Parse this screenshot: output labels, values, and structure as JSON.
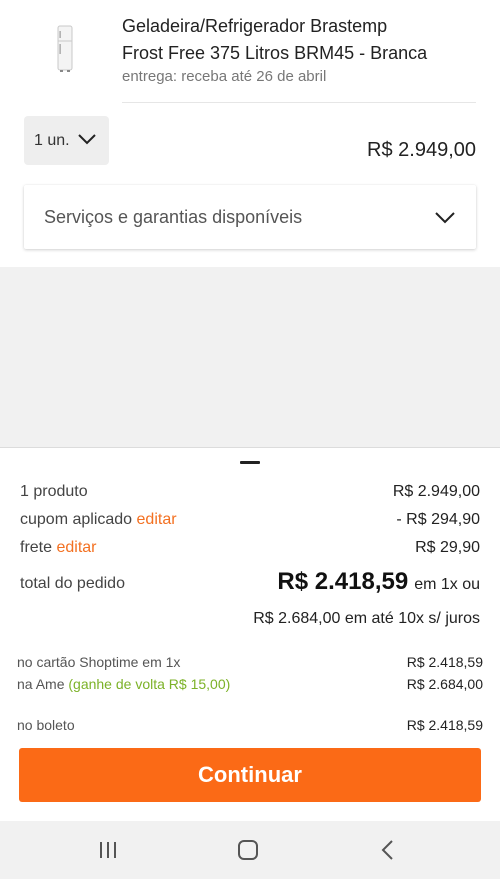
{
  "product": {
    "title_line1": "Geladeira/Refrigerador Brastemp",
    "title_line2": "Frost Free 375 Litros BRM45 - Branca",
    "delivery": "entrega: receba até 26 de abril",
    "thumb_icon": "refrigerator-image"
  },
  "quantity": {
    "selected": "1 un.",
    "icon": "chevron-down-icon"
  },
  "price": "R$ 2.949,00",
  "services": {
    "label": "Serviços e garantias disponíveis",
    "icon": "chevron-down-icon"
  },
  "summary": {
    "products_label": "1 produto",
    "products_value": "R$ 2.949,00",
    "coupon_label": "cupom aplicado",
    "coupon_edit": "editar",
    "coupon_value": "- R$ 294,90",
    "shipping_label": "frete",
    "shipping_edit": "editar",
    "shipping_value": "R$ 29,90",
    "total_label": "total do pedido",
    "total_value": "R$ 2.418,59",
    "total_suffix": "em 1x ou",
    "installments": "R$ 2.684,00 em até 10x s/ juros"
  },
  "payment": {
    "card_label": "no cartão Shoptime em 1x",
    "card_value": "R$ 2.418,59",
    "ame_label": "na Ame",
    "ame_cashback": "(ganhe de volta R$ 15,00)",
    "ame_value": "R$ 2.684,00",
    "boleto_label": "no boleto",
    "boleto_value": "R$ 2.418,59"
  },
  "continue_label": "Continuar",
  "colors": {
    "accent_orange": "#fb6a16",
    "link_orange": "#f37021",
    "discount_green": "#7cb228"
  },
  "navigation": {
    "recents_icon": "recents-icon",
    "home_icon": "home-icon",
    "back_icon": "back-icon"
  }
}
